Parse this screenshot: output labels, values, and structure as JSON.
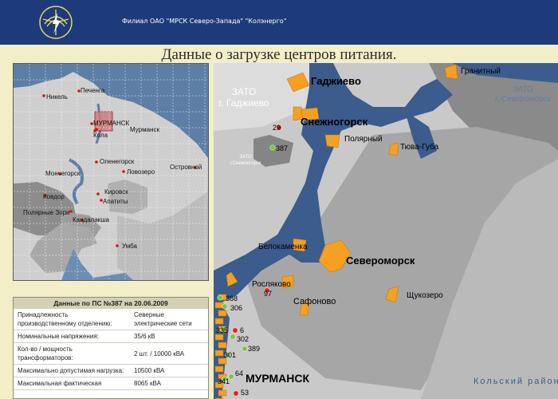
{
  "header": {
    "org": "Филиал ОАО \"МРСК Северо-Запада\" \"Колэнерго\"",
    "bg_color": "#1d3b7a",
    "logo_icon": "lightning-emblem-icon"
  },
  "page_title": "Данные о загрузке центров питания.",
  "minimap": {
    "cities": [
      {
        "name": "Никель"
      },
      {
        "name": "Печенга"
      },
      {
        "name": "Мурманск"
      },
      {
        "name": "МУРМАНСК"
      },
      {
        "name": "Кола"
      },
      {
        "name": "Оленегорск"
      },
      {
        "name": "Мончегорск"
      },
      {
        "name": "Ловозеро"
      },
      {
        "name": "Островной"
      },
      {
        "name": "Кировск"
      },
      {
        "name": "Апатиты"
      },
      {
        "name": "Ковдор"
      },
      {
        "name": "Полярные Зори"
      },
      {
        "name": "Кандалакша"
      },
      {
        "name": "Умба"
      }
    ]
  },
  "info": {
    "title": "Данные по ПС №387 на 20.06.2009",
    "rows": [
      {
        "k": "Принадлежность производственному отделению:",
        "v": "Северные электрические сети"
      },
      {
        "k": "Номинальные напряжения:",
        "v": "35/6 кВ"
      },
      {
        "k": "Кол-во / мощность трансформаторов:",
        "v": "2 шт. / 10000 кВА"
      },
      {
        "k": "Максимально допустимая нагрузка:",
        "v": "10500 кВА"
      },
      {
        "k": "Максимальная фактическая",
        "v": "8065 кВА"
      }
    ]
  },
  "bigmap": {
    "zones": [
      {
        "line1": "ЗАТО",
        "line2": "г. Гаджиево"
      },
      {
        "line1": "ЗАТО",
        "line2": "г. Североморск"
      },
      {
        "line1": "ЗАТО",
        "line2": "г.Снежногорск"
      }
    ],
    "district": "Кольский район",
    "places": [
      {
        "name": "Гаджиево"
      },
      {
        "name": "Гранитный"
      },
      {
        "name": "Снежногорск"
      },
      {
        "name": "Полярный"
      },
      {
        "name": "Тюва-Губа"
      },
      {
        "name": "Белокаменка"
      },
      {
        "name": "Североморск"
      },
      {
        "name": "Росляково"
      },
      {
        "name": "Сафоново"
      },
      {
        "name": "Щукозеро"
      },
      {
        "name": "МУРМАНСК"
      }
    ],
    "substations": [
      {
        "num": "29",
        "status": "red"
      },
      {
        "num": "387",
        "status": "green"
      },
      {
        "num": "97",
        "status": "red"
      },
      {
        "num": "388",
        "status": "green"
      },
      {
        "num": "306",
        "status": "green"
      },
      {
        "num": "335",
        "status": "green"
      },
      {
        "num": "6",
        "status": "red"
      },
      {
        "num": "302",
        "status": "green"
      },
      {
        "num": "301",
        "status": "green"
      },
      {
        "num": "389",
        "status": "green"
      },
      {
        "num": "64",
        "status": "green"
      },
      {
        "num": "341",
        "status": "green"
      },
      {
        "num": "53",
        "status": "red"
      }
    ],
    "status_colors": {
      "red": "#e02020",
      "green": "#78c832"
    },
    "colors": {
      "water": "#3b5c8c",
      "land": "#c9c9c9",
      "zato": "#858585",
      "district": "#a6a6a6",
      "city_block": "#f4a020"
    }
  }
}
